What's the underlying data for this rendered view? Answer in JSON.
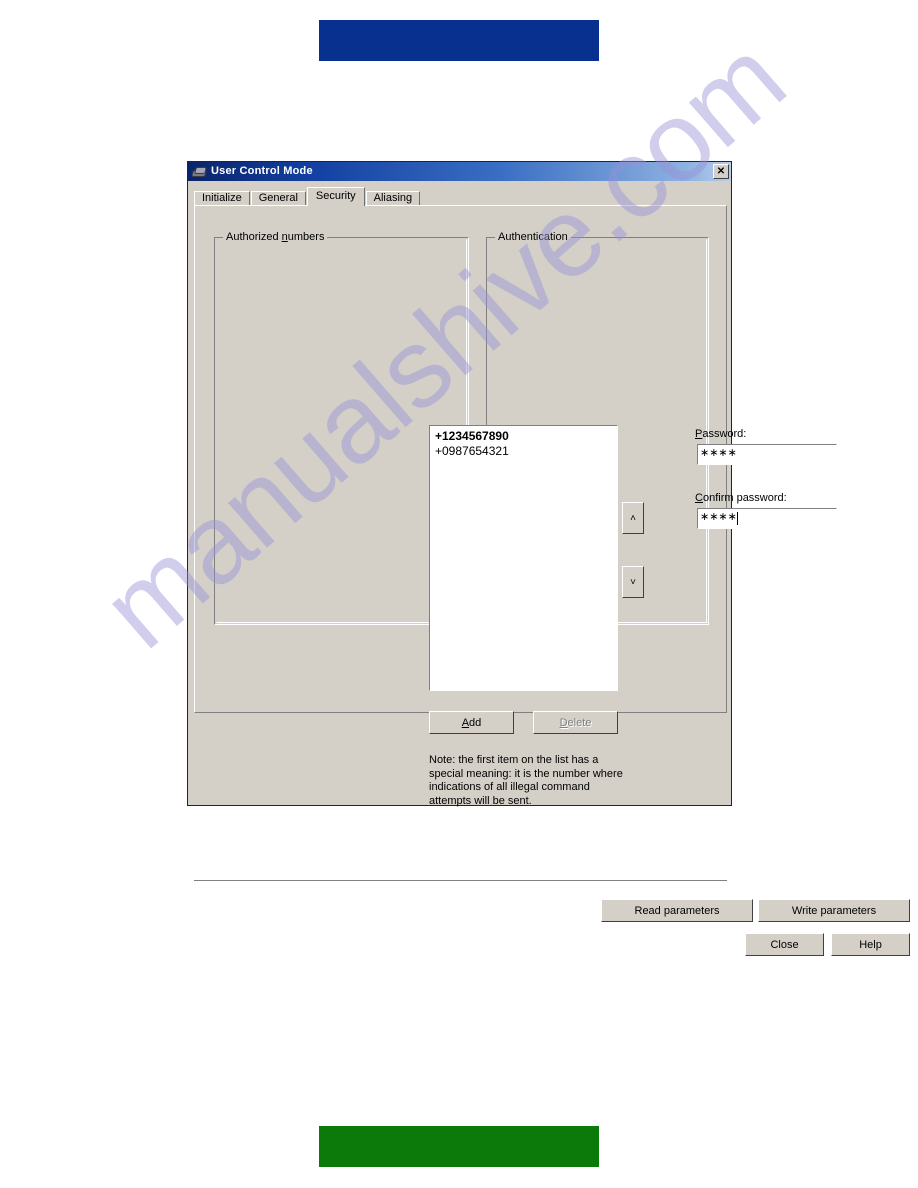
{
  "page": {
    "top_banner_color": "#08308f",
    "bottom_banner_color": "#0b7a0b",
    "watermark_text": "manualshive.com"
  },
  "dialog": {
    "title": "User Control Mode",
    "icon": "hardware-device-icon",
    "close_label": "✕"
  },
  "tabs": [
    {
      "label": "Initialize",
      "active": false
    },
    {
      "label": "General",
      "active": false
    },
    {
      "label": "Security",
      "active": true
    },
    {
      "label": "Aliasing",
      "active": false
    }
  ],
  "authorized_numbers": {
    "group_title_pre": "Authorized ",
    "group_title_accel": "n",
    "group_title_post": "umbers",
    "items": [
      {
        "value": "+1234567890",
        "bold": true
      },
      {
        "value": "+0987654321",
        "bold": false
      }
    ],
    "move_up_label": "˄",
    "move_down_label": "˅",
    "add": {
      "pre": "",
      "accel": "A",
      "post": "dd",
      "enabled": true
    },
    "delete": {
      "pre": "",
      "accel": "D",
      "post": "elete",
      "enabled": false
    },
    "note": "Note: the first item on the list has a special meaning: it is the number where indications of all illegal command attempts will be sent."
  },
  "authentication": {
    "group_title": "Authentication",
    "password": {
      "label_accel": "P",
      "label_post": "assword:",
      "value": "∗∗∗∗",
      "focused": false
    },
    "confirm_password": {
      "label_accel": "C",
      "label_post": "onfirm password:",
      "value": "∗∗∗∗",
      "focused": true
    }
  },
  "actions": {
    "read_parameters": "Read parameters",
    "write_parameters": "Write parameters",
    "close": "Close",
    "help": "Help"
  }
}
